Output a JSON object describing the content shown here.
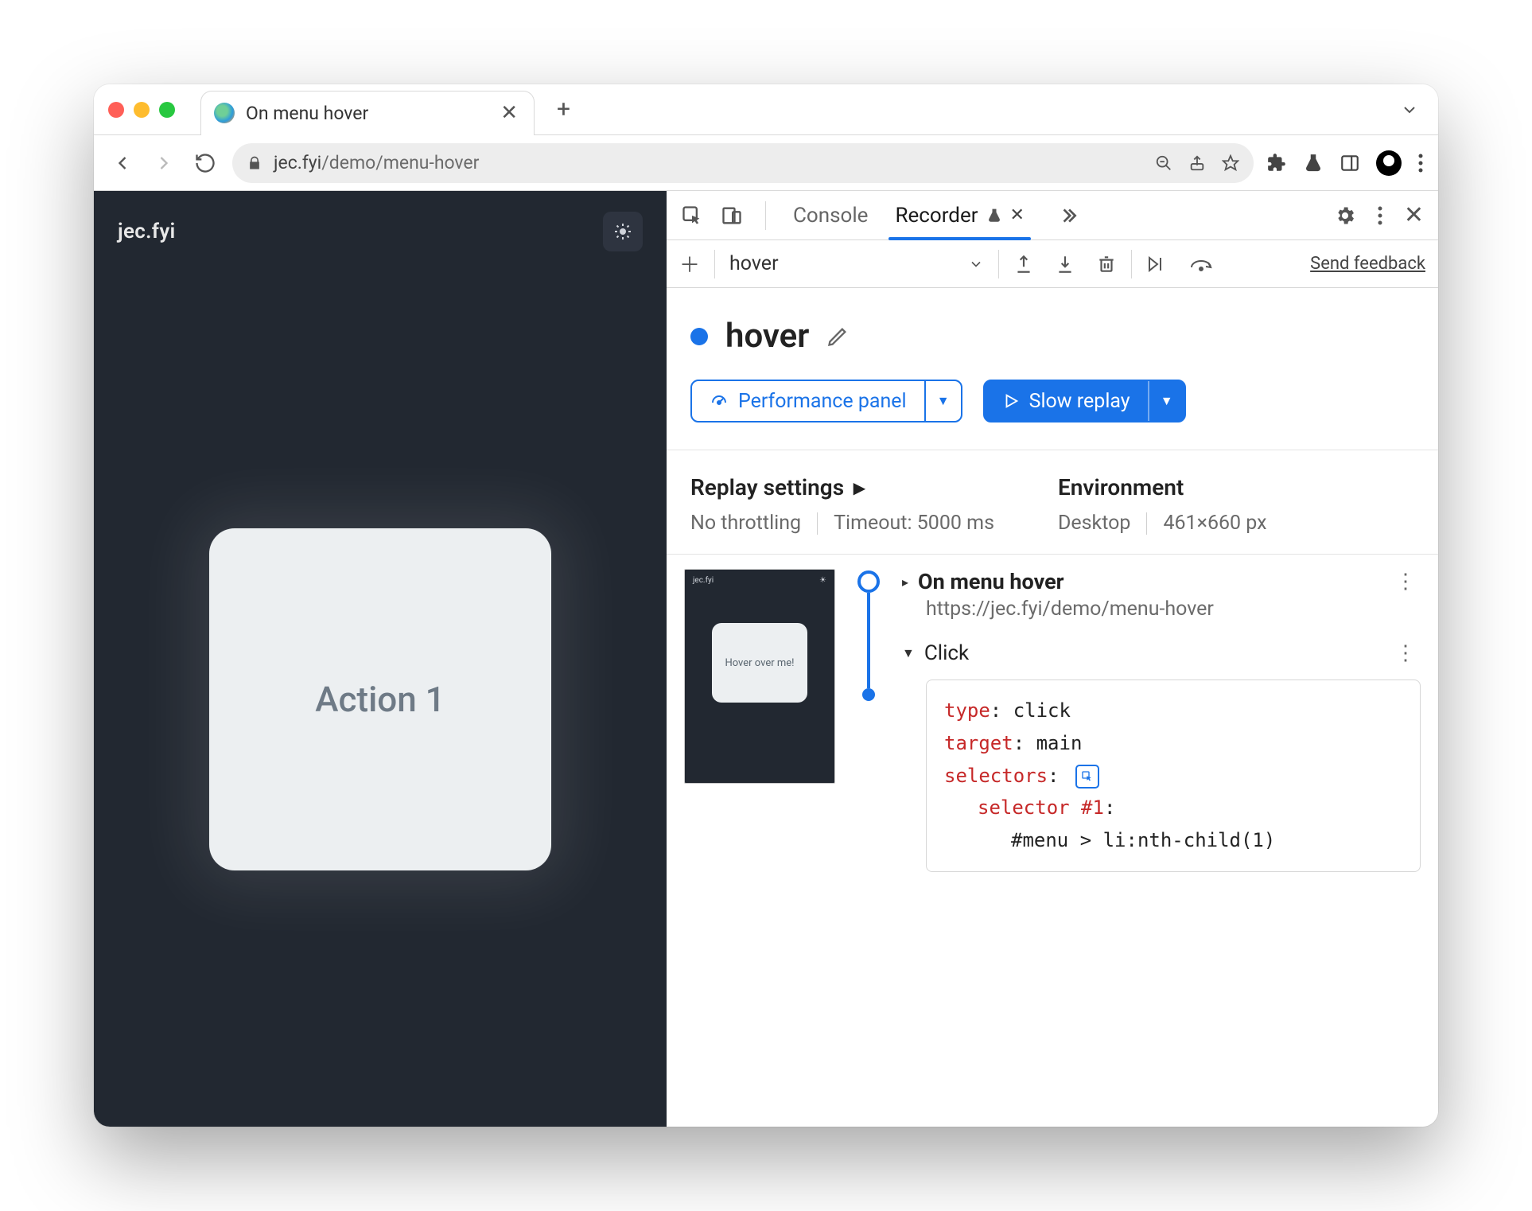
{
  "browser": {
    "tab_title": "On menu hover",
    "url_display_prefix": "jec.fyi",
    "url_display_rest": "/demo/menu-hover"
  },
  "page": {
    "brand": "jec.fyi",
    "card_text": "Action 1",
    "thumb_brand": "jec.fyi",
    "thumb_card_text": "Hover over me!"
  },
  "devtools": {
    "tabs": {
      "console": "Console",
      "recorder": "Recorder"
    },
    "feedback": "Send feedback",
    "recording_select": "hover",
    "recording_title": "hover",
    "perf_btn": "Performance panel",
    "replay_btn": "Slow replay",
    "settings": {
      "heading": "Replay settings",
      "throttling": "No throttling",
      "timeout": "Timeout: 5000 ms",
      "env_heading": "Environment",
      "env_device": "Desktop",
      "env_size": "461×660 px"
    },
    "steps": {
      "nav_title": "On menu hover",
      "nav_url": "https://jec.fyi/demo/menu-hover",
      "click_label": "Click",
      "code": {
        "type_k": "type",
        "type_v": ": click",
        "target_k": "target",
        "target_v": ": main",
        "selectors_k": "selectors",
        "selectors_v": ":",
        "sel1_k": "selector #1",
        "sel1_v": ":",
        "sel1_body": "#menu > li:nth-child(1)"
      }
    }
  }
}
